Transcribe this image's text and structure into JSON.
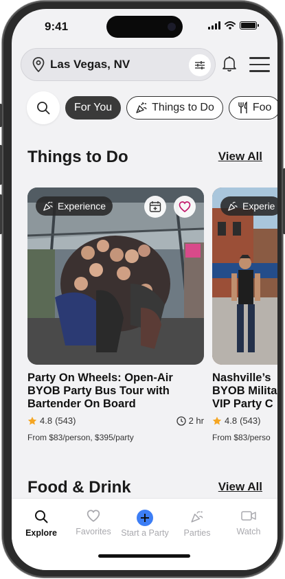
{
  "status_bar": {
    "time": "9:41"
  },
  "header": {
    "location": "Las Vegas, NV",
    "location_icon": "map-pin-icon",
    "filter_icon": "sliders-icon",
    "notification_icon": "bell-icon",
    "menu_icon": "hamburger-menu-icon"
  },
  "chips": [
    {
      "label": "For You",
      "active": true
    },
    {
      "label": "Things to Do",
      "icon": "party-popper-icon"
    },
    {
      "label": "Foo",
      "icon": "fork-knife-icon"
    }
  ],
  "things_to_do": {
    "title": "Things to Do",
    "view_all": "View All",
    "cards": [
      {
        "badge": "Experience",
        "title": "Party On Wheels: Open-Air BYOB Party Bus Tour with Bartender On Board",
        "rating": "4.8",
        "reviews": "(543)",
        "duration": "2 hr",
        "price": "From $83/person, $395/party"
      },
      {
        "badge": "Experie",
        "title_lines": [
          "Nashville’s",
          "BYOB Milita",
          "VIP Party C"
        ],
        "rating": "4.8",
        "reviews": "(543)",
        "price": "From $83/perso"
      }
    ]
  },
  "food_drink": {
    "title": "Food & Drink",
    "view_all": "View All"
  },
  "tabbar": [
    {
      "label": "Explore",
      "icon": "search-icon",
      "active": true
    },
    {
      "label": "Favorites",
      "icon": "heart-icon"
    },
    {
      "label": "Start a Party",
      "icon": "plus-circle-icon"
    },
    {
      "label": "Parties",
      "icon": "party-popper-icon"
    },
    {
      "label": "Watch",
      "icon": "video-camera-icon"
    }
  ],
  "colors": {
    "accent_blue": "#3d7ef5",
    "heart_pink": "#c2186b",
    "star": "#f5a623",
    "dark_chip": "#3a3a3a"
  }
}
